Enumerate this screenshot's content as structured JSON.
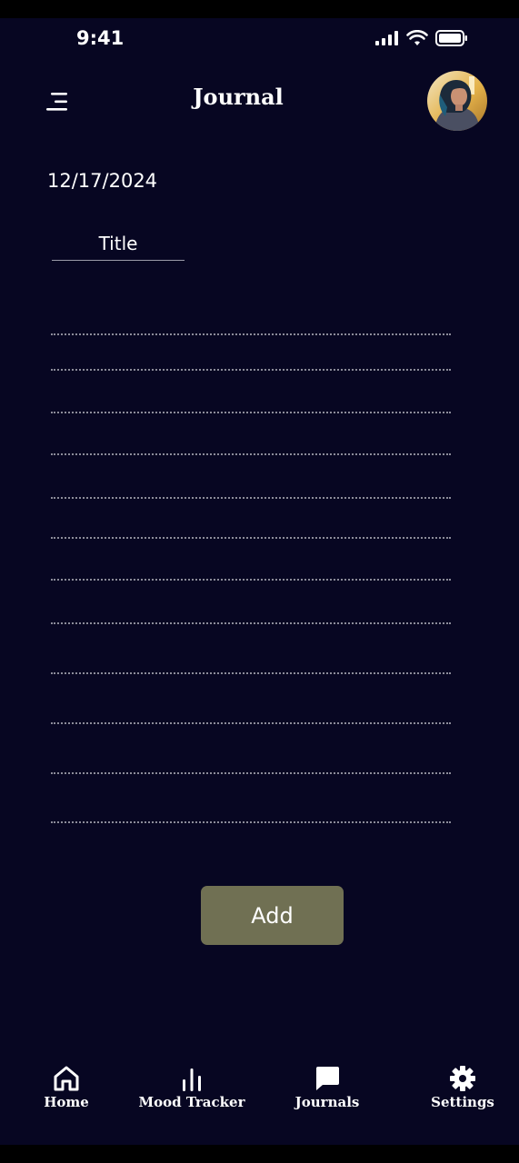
{
  "status": {
    "time": "9:41"
  },
  "header": {
    "title": "Journal",
    "menu_icon": "menu-icon",
    "avatar": "profile-avatar"
  },
  "entry": {
    "date": "12/17/2024",
    "title_placeholder": "Title",
    "line_count": 12
  },
  "actions": {
    "add_label": "Add",
    "add_color": "#707053"
  },
  "nav": {
    "items": [
      {
        "label": "Home",
        "icon": "home-icon"
      },
      {
        "label": "Mood Tracker",
        "icon": "bar-chart-icon"
      },
      {
        "label": "Journals",
        "icon": "chat-bubble-icon"
      },
      {
        "label": "Settings",
        "icon": "gear-icon"
      }
    ]
  },
  "colors": {
    "background": "#070622",
    "text": "#ffffff",
    "accent": "#707053"
  }
}
